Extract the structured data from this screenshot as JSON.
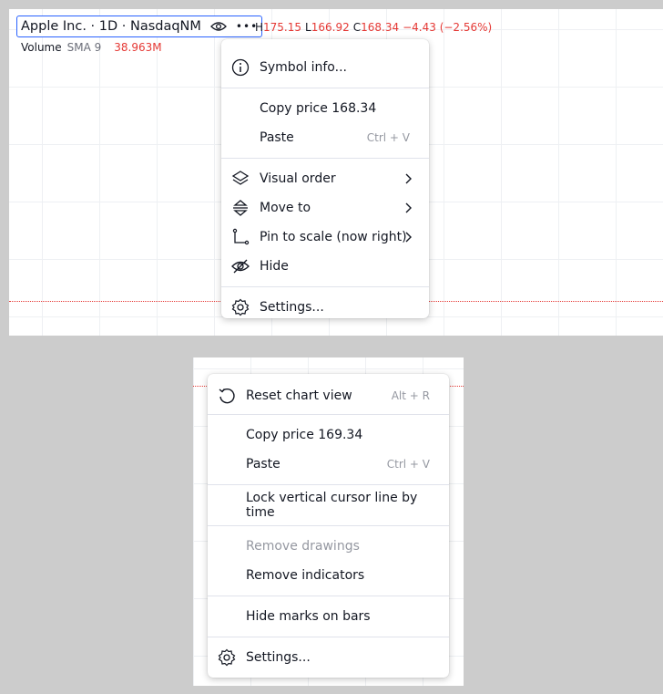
{
  "top": {
    "legend": {
      "title": "Apple Inc. · 1D · NasdaqNM",
      "more": "•••",
      "high_key": "H",
      "high": "175.15",
      "low_key": "L",
      "low": "166.92",
      "close_key": "C",
      "close": "168.34",
      "change": "−4.43 (−2.56%)"
    },
    "volume": {
      "label": "Volume",
      "sma": "SMA 9",
      "value": "38.963M"
    },
    "menu": {
      "symbol_info": "Symbol info...",
      "copy_price": "Copy price 168.34",
      "paste": "Paste",
      "paste_shortcut": "Ctrl + V",
      "visual_order": "Visual order",
      "move_to": "Move to",
      "pin_to_scale": "Pin to scale (now right)",
      "hide": "Hide",
      "settings": "Settings..."
    }
  },
  "bottom": {
    "menu": {
      "reset_chart_view": "Reset chart view",
      "reset_shortcut": "Alt + R",
      "copy_price": "Copy price 169.34",
      "paste": "Paste",
      "paste_shortcut": "Ctrl + V",
      "lock_cursor": "Lock vertical cursor line by time",
      "remove_drawings": "Remove drawings",
      "remove_indicators": "Remove indicators",
      "hide_marks": "Hide marks on bars",
      "settings": "Settings..."
    }
  },
  "colors": {
    "accent": "#2962ff",
    "down": "#e53935",
    "muted": "#9598a1"
  }
}
